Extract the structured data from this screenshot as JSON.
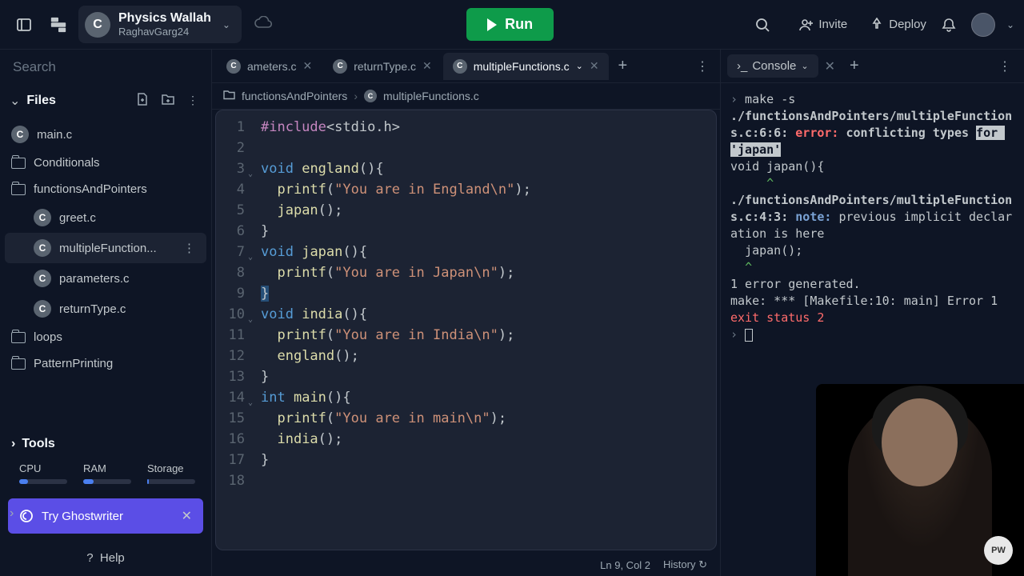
{
  "topbar": {
    "workspace_title": "Physics Wallah",
    "workspace_sub": "RaghavGarg24",
    "run_label": "Run",
    "deploy_label": "Deploy",
    "invite_label": "Invite"
  },
  "sidebar": {
    "search_placeholder": "Search",
    "files_label": "Files",
    "tree": [
      {
        "type": "c",
        "label": "main.c"
      },
      {
        "type": "folder",
        "label": "Conditionals"
      },
      {
        "type": "folder",
        "label": "functionsAndPointers"
      },
      {
        "type": "c",
        "label": "greet.c",
        "nested": true
      },
      {
        "type": "c",
        "label": "multipleFunction...",
        "nested": true,
        "active": true
      },
      {
        "type": "c",
        "label": "parameters.c",
        "nested": true
      },
      {
        "type": "c",
        "label": "returnType.c",
        "nested": true
      },
      {
        "type": "folder",
        "label": "loops"
      },
      {
        "type": "folder",
        "label": "PatternPrinting"
      }
    ],
    "tools_label": "Tools",
    "stats": {
      "cpu": "CPU",
      "cpu_pct": 18,
      "ram": "RAM",
      "ram_pct": 22,
      "storage": "Storage",
      "storage_pct": 4
    },
    "ghost_label": "Try Ghostwriter",
    "help_label": "Help"
  },
  "editor": {
    "tabs": [
      {
        "label": "ameters.c",
        "active": false
      },
      {
        "label": "returnType.c",
        "active": false
      },
      {
        "label": "multipleFunctions.c",
        "active": true
      }
    ],
    "crumb_folder": "functionsAndPointers",
    "crumb_file": "multipleFunctions.c",
    "code_lines": [
      {
        "n": 1,
        "html": "<span class='inc'>#include</span>&lt;stdio.h&gt;"
      },
      {
        "n": 2,
        "html": ""
      },
      {
        "n": 3,
        "html": "<span class='typ'>void</span> <span class='fn'>england</span>(){",
        "fold": true
      },
      {
        "n": 4,
        "html": "  <span class='fn'>printf</span>(<span class='str'>\"You are in England\\n\"</span>);"
      },
      {
        "n": 5,
        "html": "  <span class='fn'>japan</span>();"
      },
      {
        "n": 6,
        "html": "}"
      },
      {
        "n": 7,
        "html": "<span class='typ'>void</span> <span class='fn'>japan</span>(){",
        "fold": true
      },
      {
        "n": 8,
        "html": "  <span class='fn'>printf</span>(<span class='str'>\"You are in Japan\\n\"</span>);"
      },
      {
        "n": 9,
        "html": "<span class='hl'>}</span>"
      },
      {
        "n": 10,
        "html": "<span class='typ'>void</span> <span class='fn'>india</span>(){",
        "fold": true
      },
      {
        "n": 11,
        "html": "  <span class='fn'>printf</span>(<span class='str'>\"You are in India\\n\"</span>);"
      },
      {
        "n": 12,
        "html": "  <span class='fn'>england</span>();"
      },
      {
        "n": 13,
        "html": "}"
      },
      {
        "n": 14,
        "html": "<span class='typ'>int</span> <span class='fn'>main</span>(){",
        "fold": true
      },
      {
        "n": 15,
        "html": "  <span class='fn'>printf</span>(<span class='str'>\"You are in main\\n\"</span>);"
      },
      {
        "n": 16,
        "html": "  <span class='fn'>india</span>();"
      },
      {
        "n": 17,
        "html": "}"
      },
      {
        "n": 18,
        "html": ""
      }
    ],
    "status_pos": "Ln 9, Col 2",
    "status_history": "History"
  },
  "console": {
    "tab_label": "Console",
    "lines": [
      {
        "html": "<span class='cb-prompt'>›</span> make -s"
      },
      {
        "html": "<b>./functionsAndPointers/multipleFunctions.c:6:6:</b> <span class='cb-err'>error:</span> <b>conflicting types <span class='cb-hl'>for 'japan'</span></b>"
      },
      {
        "html": "void japan(){"
      },
      {
        "html": "     <span class='cb-caret'>^</span>"
      },
      {
        "html": "<b>./functionsAndPointers/multipleFunctions.c:4:3:</b> <span class='cb-note'>note:</span> previous implicit declaration is here"
      },
      {
        "html": "  japan();"
      },
      {
        "html": "  <span class='cb-caret'>^</span>"
      },
      {
        "html": "1 error generated."
      },
      {
        "html": "make: *** [Makefile:10: main] Error 1"
      },
      {
        "html": "<span class='cb-exit'>exit status 2</span>"
      },
      {
        "html": "<span class='cb-prompt'>›</span> <span class='cursor-box'></span>"
      }
    ],
    "webcam_badge": "PW"
  }
}
